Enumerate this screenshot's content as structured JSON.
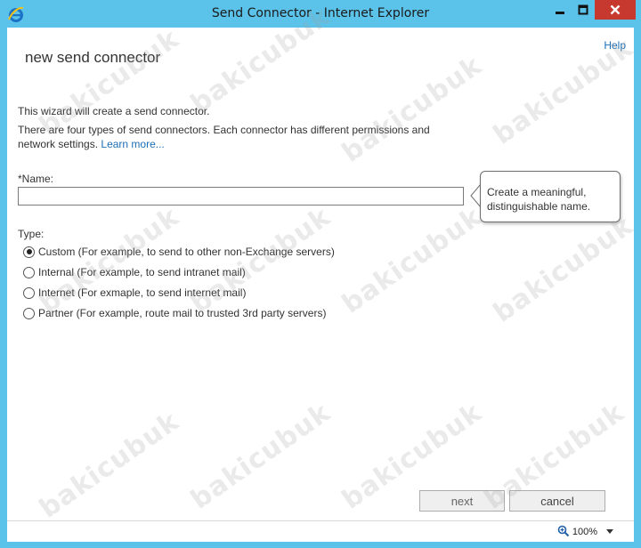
{
  "window": {
    "title": "Send Connector - Internet Explorer",
    "accent_color": "#5bc3ea",
    "close_color": "#c7382e",
    "icons": [
      "ie-icon",
      "minimize-icon",
      "maximize-icon",
      "close-icon"
    ]
  },
  "header": {
    "help_label": "Help",
    "page_title": "new send connector"
  },
  "wizard": {
    "intro_text": "This wizard will create a send connector.",
    "description_text": "There are four types of send connectors. Each connector has different permissions and network settings.",
    "learn_more_label": "Learn more...",
    "name_label": "*Name:",
    "name_value": "",
    "tooltip_text": "Create a meaningful, distinguishable name.",
    "type_label": "Type:",
    "type_options": [
      {
        "label": "Custom (For example, to send to other non-Exchange servers)",
        "selected": true
      },
      {
        "label": "Internal (For example, to send intranet mail)",
        "selected": false
      },
      {
        "label": "Internet (For exmaple, to send internet mail)",
        "selected": false
      },
      {
        "label": "Partner (For example, route mail to trusted 3rd party servers)",
        "selected": false
      }
    ]
  },
  "buttons": {
    "next_label": "next",
    "cancel_label": "cancel"
  },
  "statusbar": {
    "zoom_label": "100%",
    "zoom_icon": "zoom-icon"
  },
  "watermark": {
    "text": "bakicubuk"
  }
}
